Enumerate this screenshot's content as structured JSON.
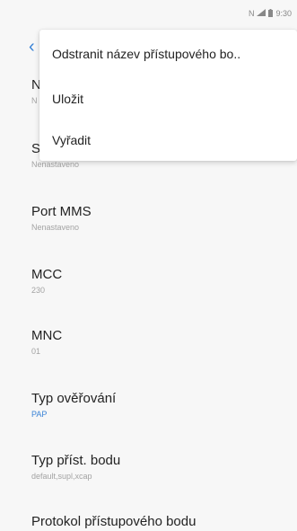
{
  "status_bar": {
    "icons": [
      "nfc-icon",
      "signal-icon",
      "battery-icon"
    ],
    "time": "9:30"
  },
  "menu": {
    "items": [
      "Odstranit název přístupového bo..",
      "Uložit",
      "Vyřadit"
    ]
  },
  "settings": {
    "partial_rows": [
      {
        "title_fragment": "N",
        "value_fragment": "N"
      },
      {
        "title_fragment": "S",
        "value": "Nenastaveno"
      }
    ],
    "rows": [
      {
        "title": "Port MMS",
        "value": "Nenastaveno"
      },
      {
        "title": "MCC",
        "value": "230"
      },
      {
        "title": "MNC",
        "value": "01"
      },
      {
        "title": "Typ ověřování",
        "value": "PAP"
      },
      {
        "title": "Typ příst. bodu",
        "value": "default,supl,xcap"
      },
      {
        "title": "Protokol přístupového bodu"
      }
    ]
  },
  "colors": {
    "accent": "#3a83d6",
    "background": "#f7f7f7",
    "secondary_text": "#a3a3a3"
  }
}
